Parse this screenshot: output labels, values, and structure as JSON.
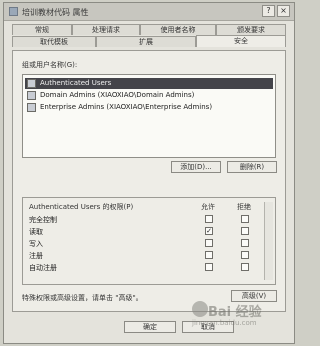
{
  "window": {
    "title": "培训教材代码 属性",
    "help_label": "?",
    "close_label": "×"
  },
  "tabs_row1": [
    "常规",
    "处理请求",
    "使用者名称",
    "颁发要求"
  ],
  "tabs_row2": [
    "取代模板",
    "扩展",
    "安全"
  ],
  "groups_label": "组或用户名称(G):",
  "users": [
    {
      "label": "Authenticated Users"
    },
    {
      "label": "Domain Admins (XIAOXIAO\\Domain Admins)"
    },
    {
      "label": "Enterprise Admins (XIAOXIAO\\Enterprise Admins)"
    }
  ],
  "buttons": {
    "add": "添加(D)...",
    "remove": "删除(R)",
    "advanced": "高级(V)",
    "ok": "确定",
    "cancel": "取消"
  },
  "permissions": {
    "header": "Authenticated Users 的权限(P)",
    "allow_label": "允许",
    "deny_label": "拒绝",
    "rows": [
      {
        "name": "完全控制",
        "allow": false,
        "deny": false
      },
      {
        "name": "读取",
        "allow": true,
        "deny": false
      },
      {
        "name": "写入",
        "allow": false,
        "deny": false
      },
      {
        "name": "注册",
        "allow": false,
        "deny": false
      },
      {
        "name": "自动注册",
        "allow": false,
        "deny": false
      }
    ]
  },
  "advanced_hint": "特殊权限或高级设置，请单击 \"高级\"。",
  "watermark": {
    "text": "Bai 经验",
    "url": "jingyan.baidu.com"
  },
  "colors": {
    "selection": "#44444a",
    "window_bg": "#e4e3dc",
    "panel_bg": "#eeede7"
  }
}
